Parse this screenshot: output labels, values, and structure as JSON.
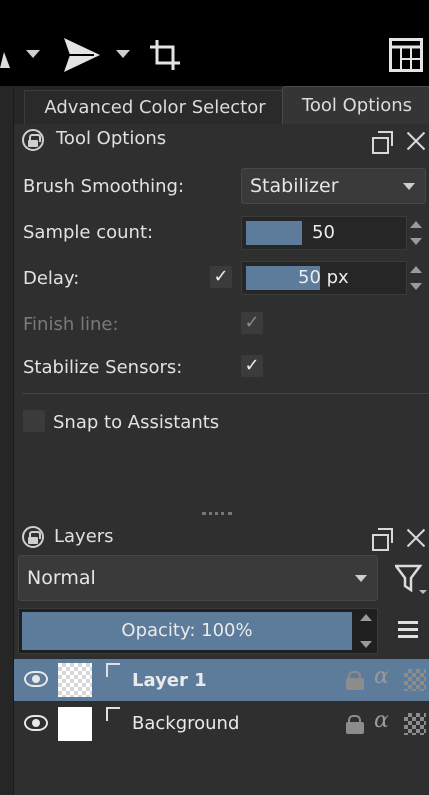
{
  "toolbar": {
    "icons": [
      "arrow-icon",
      "chevron-down-icon",
      "send-icon",
      "chevron-down-icon",
      "crop-icon",
      "panel-layout-icon"
    ]
  },
  "tabs": [
    {
      "label": "Advanced Color Selector",
      "active": false
    },
    {
      "label": "Tool Options",
      "active": true
    }
  ],
  "tool_options": {
    "title": "Tool Options",
    "brush_smoothing": {
      "label": "Brush Smoothing:",
      "value": "Stabilizer"
    },
    "sample_count": {
      "label": "Sample count:",
      "value": "50",
      "fill_fraction": 0.34
    },
    "delay": {
      "label": "Delay:",
      "checked": true,
      "value": "50 px",
      "fill_fraction": 0.5
    },
    "finish_line": {
      "label": "Finish line:",
      "checked": true,
      "enabled": false
    },
    "stabilize_sensors": {
      "label": "Stabilize Sensors:",
      "checked": true
    },
    "snap_to_assistants": {
      "label": "Snap to Assistants",
      "checked": false
    }
  },
  "layers": {
    "title": "Layers",
    "blend_mode": "Normal",
    "opacity_text": "Opacity:  100%",
    "opacity_fraction": 1.0,
    "items": [
      {
        "name": "Layer 1",
        "selected": true,
        "visible": true
      },
      {
        "name": "Background",
        "selected": false,
        "visible": true
      }
    ]
  },
  "colors": {
    "accent": "#5d7c9b",
    "panel": "#2f2f2f",
    "topbar": "#000000"
  }
}
